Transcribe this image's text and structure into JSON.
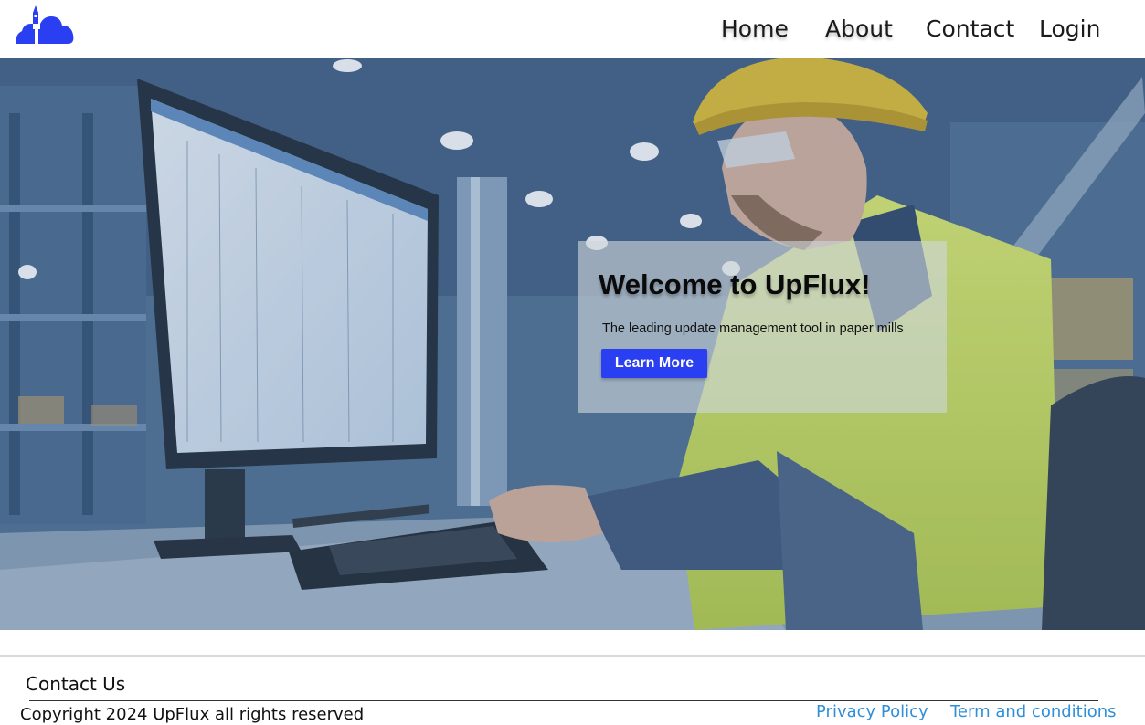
{
  "header": {
    "logo_icon": "rocket-cloud-logo-icon",
    "logo_color": "#2b3ff2",
    "nav": [
      {
        "label": "Home"
      },
      {
        "label": "About"
      },
      {
        "label": "Contact"
      },
      {
        "label": "Login"
      }
    ]
  },
  "hero": {
    "background_image": "factory-worker-at-computer-photo",
    "title": "Welcome to UpFlux!",
    "subtitle": "The leading update management tool in paper mills",
    "cta_label": "Learn More",
    "cta_color": "#2b3ff2"
  },
  "footer": {
    "title": "Contact Us",
    "copyright": "Copyright 2024 UpFlux all rights reserved",
    "links": [
      {
        "label": "Privacy Policy"
      },
      {
        "label": "Term and conditions"
      }
    ],
    "link_color": "#2f8fd8"
  }
}
